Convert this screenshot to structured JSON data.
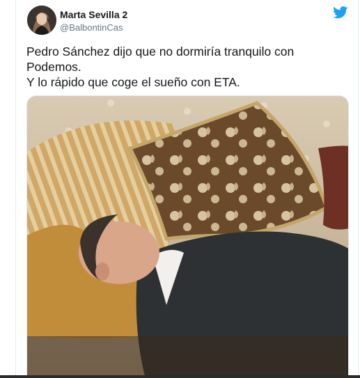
{
  "tweet": {
    "author_name": "Marta Sevilla 2",
    "author_handle": "@BalbontinCas",
    "text_lines": [
      "Pedro Sánchez dijo que no dormiría tranquilo con",
      "Podemos.",
      "Y lo rápido que coge el sueño con ETA."
    ]
  },
  "icons": {
    "logo": "twitter-bird-icon",
    "logo_color": "#1da1f2"
  }
}
